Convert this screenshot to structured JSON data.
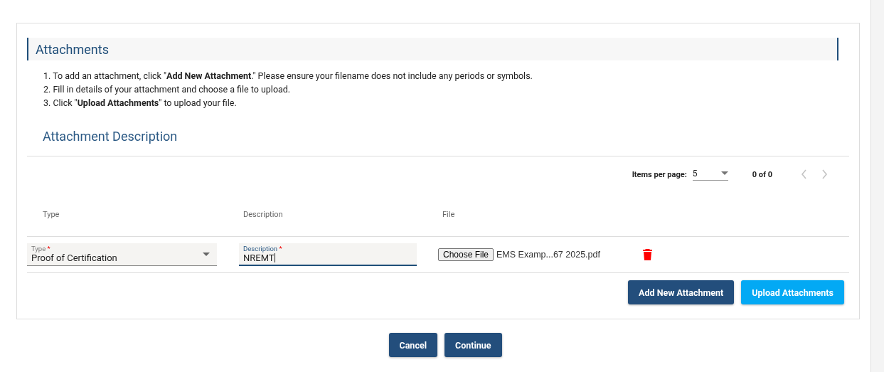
{
  "section": {
    "title": "Attachments",
    "instructions": [
      "1. To add an attachment, click \"**Add New Attachment**.\" Please ensure your filename does not include any periods or symbols.",
      "2. Fill in details of your attachment and choose a file to upload.",
      "3. Click \"**Upload Attachments**\" to upload your file."
    ],
    "subtitle": "Attachment Description"
  },
  "paginator": {
    "label": "Items per page:",
    "page_size": "5",
    "range": "0 of 0",
    "prev_disabled": true,
    "next_disabled": true
  },
  "table": {
    "columns": [
      "Type",
      "Description",
      "File"
    ],
    "rows": [
      {
        "type": {
          "label": "Type",
          "required": "*",
          "value": "Proof of Certification"
        },
        "description": {
          "label": "Description",
          "required": "*",
          "value": "NREMT",
          "focused": true
        },
        "file": {
          "button": "Choose File",
          "name": "EMS Examp...67 2025.pdf"
        }
      }
    ]
  },
  "actions": [
    "Add New Attachment",
    "Upload Attachments"
  ],
  "footer_buttons": [
    "Cancel",
    "Continue"
  ]
}
